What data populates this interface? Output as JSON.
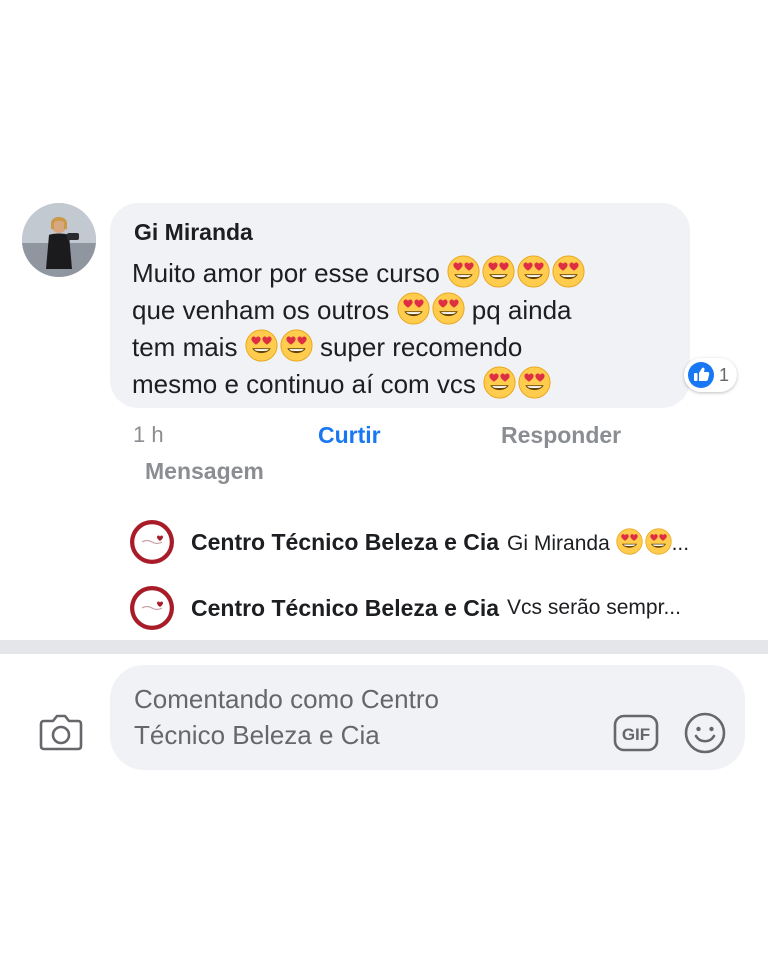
{
  "comment": {
    "author": "Gi Miranda",
    "lines": [
      {
        "text": "Muito amor por esse curso",
        "emoji_count": 4
      },
      {
        "text": "que venham os outros",
        "emoji_count": 2,
        "after": "pq ainda"
      },
      {
        "text": "tem mais",
        "emoji_count": 2,
        "after": "super recomendo"
      },
      {
        "text": "mesmo e continuo aí com vcs",
        "emoji_count": 2
      }
    ],
    "reaction": {
      "icon": "like-icon",
      "count": "1"
    }
  },
  "actions": {
    "time": "1 h",
    "like": "Curtir",
    "reply": "Responder",
    "message": "Mensagem"
  },
  "replies": [
    {
      "author": "Centro Técnico Beleza e Cia",
      "text_before": "Gi Miranda",
      "emoji_count": 2,
      "text_after": "..."
    },
    {
      "author": "Centro Técnico Beleza e Cia",
      "text_before": "Vcs serão sempr...",
      "emoji_count": 0,
      "text_after": ""
    }
  ],
  "composer": {
    "placeholder_line1": "Comentando como Centro",
    "placeholder_line2": "Técnico Beleza e Cia",
    "camera_icon": "camera-icon",
    "gif_label": "GIF",
    "emoji_icon": "smiley-icon"
  },
  "colors": {
    "accent": "#1877f2",
    "bubble": "#f0f2f5",
    "muted": "#8a8d91",
    "brand_ring": "#a81c2a"
  }
}
